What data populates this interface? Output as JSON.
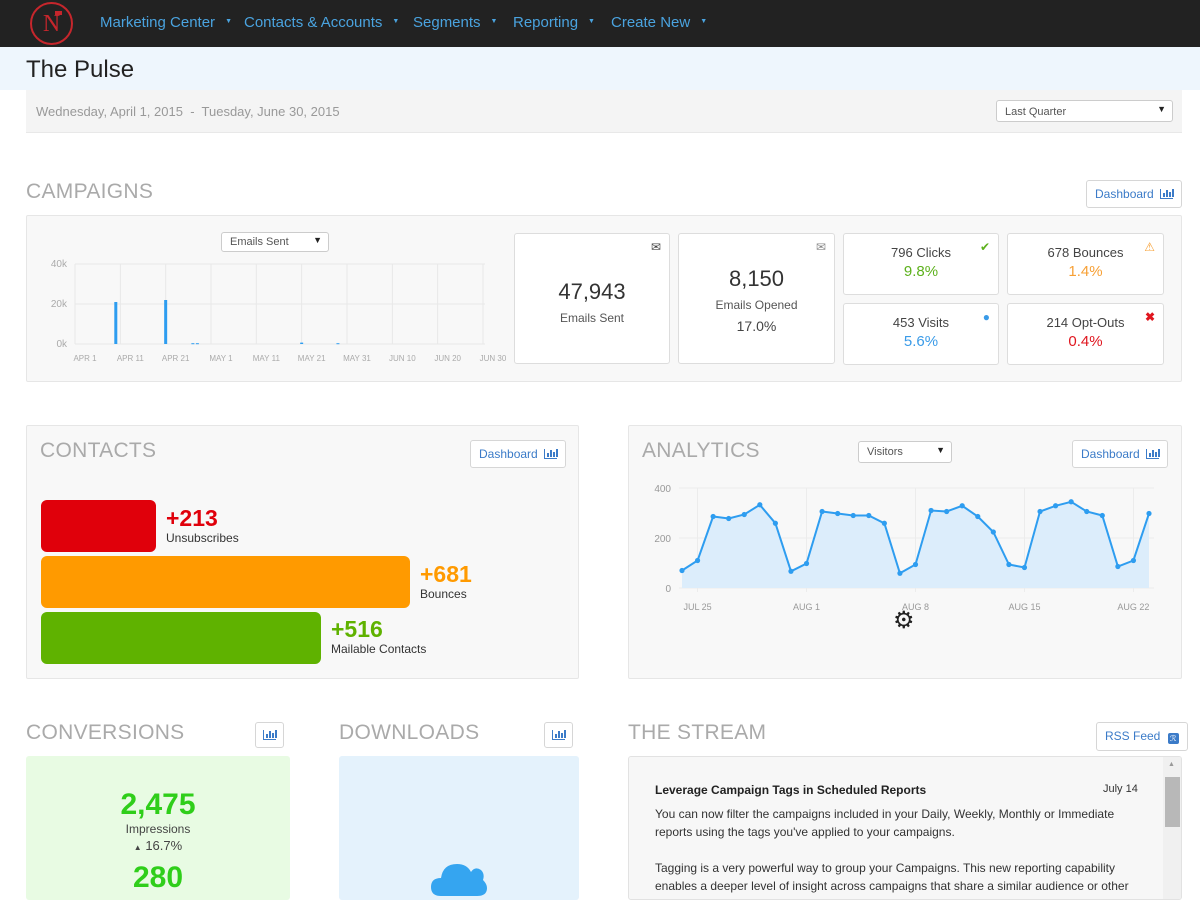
{
  "nav": {
    "logo_letter": "N",
    "items": [
      {
        "label": "Marketing Center"
      },
      {
        "label": "Contacts & Accounts"
      },
      {
        "label": "Segments"
      },
      {
        "label": "Reporting"
      },
      {
        "label": "Create New"
      }
    ]
  },
  "page": {
    "title": "The Pulse"
  },
  "date_range": {
    "start": "Wednesday, April 1, 2015",
    "separator": "-",
    "end": "Tuesday, June 30, 2015",
    "period_select": "Last Quarter"
  },
  "campaigns": {
    "title": "CAMPAIGNS",
    "dashboard_label": "Dashboard",
    "metric_select": "Emails Sent",
    "emails_sent": {
      "value": "47,943",
      "label": "Emails Sent",
      "icon": "envelope-solid-icon"
    },
    "emails_opened": {
      "value": "8,150",
      "label": "Emails Opened",
      "pct": "17.0%",
      "icon": "envelope-outline-icon"
    },
    "clicks": {
      "label": "796 Clicks",
      "pct": "9.8%",
      "icon": "check-icon",
      "color": "#5db11c"
    },
    "bounces": {
      "label": "678 Bounces",
      "pct": "1.4%",
      "icon": "warning-icon",
      "color": "#f7a035"
    },
    "visits": {
      "label": "453 Visits",
      "pct": "5.6%",
      "icon": "globe-icon",
      "color": "#3a9be8"
    },
    "optouts": {
      "label": "214 Opt-Outs",
      "pct": "0.4%",
      "icon": "x-icon",
      "color": "#e0161f"
    }
  },
  "contacts": {
    "title": "CONTACTS",
    "dashboard_label": "Dashboard",
    "bars": [
      {
        "value": "+213",
        "label": "Unsubscribes",
        "count": 213,
        "color": "#e0000b"
      },
      {
        "value": "+681",
        "label": "Bounces",
        "count": 681,
        "color": "#ff9a00"
      },
      {
        "value": "+516",
        "label": "Mailable Contacts",
        "count": 516,
        "color": "#5fb200"
      }
    ]
  },
  "analytics": {
    "title": "ANALYTICS",
    "dashboard_label": "Dashboard",
    "metric_select": "Visitors"
  },
  "conversions": {
    "title": "CONVERSIONS",
    "impressions": "2,475",
    "impressions_label": "Impressions",
    "change": "16.7%",
    "second_value": "280"
  },
  "downloads": {
    "title": "DOWNLOADS"
  },
  "stream": {
    "title": "THE STREAM",
    "rss_label": "RSS Feed",
    "items": [
      {
        "title": "Leverage Campaign Tags in Scheduled Reports",
        "date": "July 14",
        "p1": "You can now filter the campaigns included in your Daily, Weekly, Monthly or Immediate reports using the tags you've applied to your campaigns.",
        "p2": "Tagging is a very powerful way to group your Campaigns. This new reporting capability enables a deeper level of insight across campaigns that share a similar audience or other"
      }
    ]
  },
  "chart_data": [
    {
      "type": "bar",
      "title": "Emails Sent",
      "xlabel": "",
      "ylabel": "",
      "ylim": [
        0,
        40000
      ],
      "yticks": [
        "0k",
        "20k",
        "40k"
      ],
      "xticks": [
        "APR 1",
        "APR 11",
        "APR 21",
        "MAY 1",
        "MAY 11",
        "MAY 21",
        "MAY 31",
        "JUN 10",
        "JUN 20",
        "JUN 30"
      ],
      "grid": true,
      "x_start": "2015-04-01",
      "x_days": 91,
      "points": [
        {
          "day": 9,
          "value": 21000
        },
        {
          "day": 20,
          "value": 22000
        },
        {
          "day": 26,
          "value": 400
        },
        {
          "day": 27,
          "value": 400
        },
        {
          "day": 50,
          "value": 700
        },
        {
          "day": 58,
          "value": 400
        }
      ]
    },
    {
      "type": "area",
      "title": "Visitors",
      "ylim": [
        0,
        400
      ],
      "yticks": [
        "0",
        "200",
        "400"
      ],
      "xticks": [
        {
          "label": "JUL 25",
          "index": 1
        },
        {
          "label": "AUG 1",
          "index": 8
        },
        {
          "label": "AUG 8",
          "index": 15
        },
        {
          "label": "AUG 15",
          "index": 22
        },
        {
          "label": "AUG 22",
          "index": 29
        }
      ],
      "grid": true,
      "values": [
        70,
        110,
        286,
        278,
        294,
        333,
        259,
        67,
        98,
        306,
        298,
        290,
        290,
        259,
        59,
        94,
        310,
        306,
        329,
        286,
        224,
        94,
        82,
        306,
        329,
        345,
        306,
        290,
        86,
        110,
        298
      ]
    }
  ]
}
